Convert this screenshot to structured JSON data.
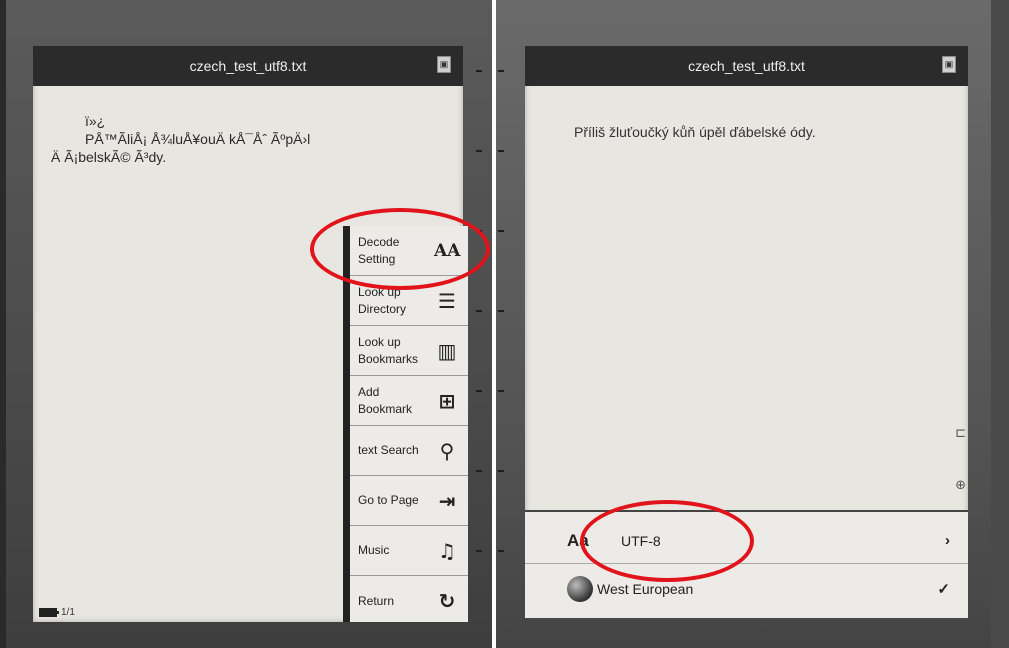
{
  "left_screen": {
    "title": "czech_test_utf8.txt",
    "garbled_text": {
      "line1": "ï»¿",
      "line2": "PÅ™Ã­liÅ¡ Å¾luÅ¥ouÄ kÅ¯Åˆ ÃºpÄ›l",
      "line3": "Ä Ã¡belskÃ© Ã³dy."
    },
    "menu": [
      {
        "label": "Decode Setting",
        "icon": "font-size-icon",
        "glyph": "AA"
      },
      {
        "label": "Look up Directory",
        "icon": "directory-icon",
        "glyph": "☰"
      },
      {
        "label": "Look up Bookmarks",
        "icon": "open-book-icon",
        "glyph": "📖"
      },
      {
        "label": "Add Bookmark",
        "icon": "add-bookmark-icon",
        "glyph": "⊞"
      },
      {
        "label": "text Search",
        "icon": "search-icon",
        "glyph": "🔍"
      },
      {
        "label": "Go to Page",
        "icon": "goto-page-icon",
        "glyph": "⇥"
      },
      {
        "label": "Music",
        "icon": "music-icon",
        "glyph": "♫"
      },
      {
        "label": "Return",
        "icon": "return-icon",
        "glyph": "↻"
      }
    ],
    "page_indicator": "1/1"
  },
  "right_screen": {
    "title": "czech_test_utf8.txt",
    "content_text": "Příliš žluťoučký kůň úpěl ďábelské ódy.",
    "decode_options": [
      {
        "label": "UTF-8",
        "icon_text": "Aa",
        "end": "›"
      },
      {
        "label": "West European",
        "icon": "globe-icon",
        "end": "✓"
      }
    ]
  },
  "colors": {
    "highlight_ring": "#e0141a",
    "screen_bg": "#e7e6e1",
    "titlebar_bg": "#2b2b2b"
  }
}
